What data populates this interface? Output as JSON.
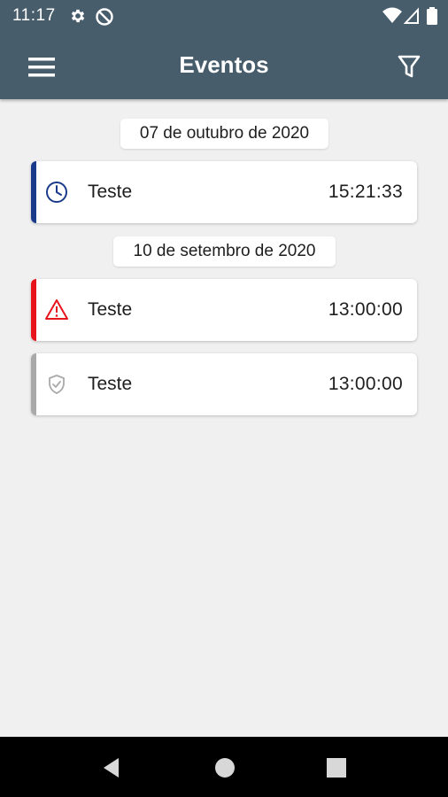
{
  "status_bar": {
    "time": "11:17",
    "icons": [
      "settings-gear-icon",
      "do-not-disturb-icon",
      "wifi-icon",
      "cell-signal-icon",
      "battery-icon"
    ]
  },
  "app_bar": {
    "title": "Eventos",
    "left_icon": "hamburger-menu-icon",
    "right_icon": "filter-icon",
    "color": "#475d6b"
  },
  "groups": [
    {
      "date": "07 de outubro de 2020",
      "events": [
        {
          "name": "Teste",
          "time": "15:21:33",
          "icon": "clock-icon",
          "color": "#1a3a8a"
        }
      ]
    },
    {
      "date": "10 de setembro de 2020",
      "events": [
        {
          "name": "Teste",
          "time": "13:00:00",
          "icon": "warning-triangle-icon",
          "color": "#e8141b"
        },
        {
          "name": "Teste",
          "time": "13:00:00",
          "icon": "shield-check-icon",
          "color": "#a9a9a9"
        }
      ]
    }
  ],
  "nav_bar": {
    "buttons": [
      "back-triangle-icon",
      "home-circle-icon",
      "recents-square-icon"
    ]
  }
}
